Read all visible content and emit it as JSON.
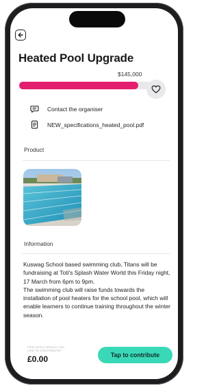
{
  "header": {
    "back_icon": "arrow-left-icon"
  },
  "campaign": {
    "title": "Heated Pool Upgrade",
    "target_amount": "$145,000",
    "progress_fraction": 0.87,
    "progress_color": "#e41e6e",
    "favorite_icon": "heart-icon"
  },
  "links": [
    {
      "icon": "chat-bubble-icon",
      "label": "Contact the organiser"
    },
    {
      "icon": "document-icon",
      "label": "NEW_specifications_heated_pool.pdf"
    }
  ],
  "product": {
    "section_label": "Product",
    "image_icon": "swimming-pool-photo"
  },
  "information": {
    "section_label": "Information",
    "paragraph1": "Kuswag School based swimming club, Titans will be fundraising at Toti's Splash Water World this Friday night, 17 March from 6pm to 9pm.",
    "paragraph2": "The swimming club will raise funds towards the installation of pool heaters for the school pool, which will enable learners to continue training throughout the winter season."
  },
  "footer": {
    "hint_line1": "How much would you",
    "hint_line2": "like to contribute?",
    "amount": "£0.00",
    "cta_label": "Tap to contribute",
    "cta_color": "#39d9b8"
  }
}
